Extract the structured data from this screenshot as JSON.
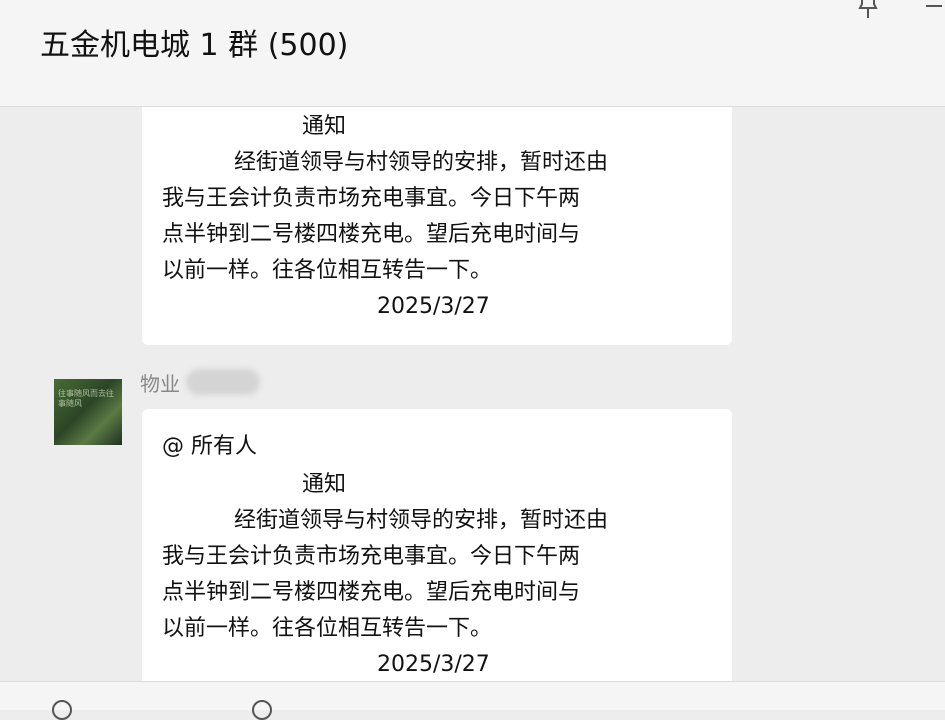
{
  "header": {
    "title": "五金机电城 1 群 (500)"
  },
  "messages": [
    {
      "title": "通知",
      "lines": [
        "经街道领导与村领导的安排，暂时还由",
        "我与王会计负责市场充电事宜。今日下午两",
        "点半钟到二号楼四楼充电。望后充电时间与",
        "以前一样。往各位相互转告一下。"
      ],
      "date": "2025/3/27"
    },
    {
      "sender": "物业",
      "mention": "@ 所有人",
      "title": "通知",
      "lines": [
        "经街道领导与村领导的安排，暂时还由",
        "我与王会计负责市场充电事宜。今日下午两",
        "点半钟到二号楼四楼充电。望后充电时间与",
        "以前一样。往各位相互转告一下。"
      ],
      "date": "2025/3/27"
    }
  ],
  "avatar": {
    "text": "往事随风而去往事随风"
  },
  "icons": {
    "pin": "pin-icon",
    "minimize": "minimize-icon",
    "avatar": "avatar-image"
  }
}
